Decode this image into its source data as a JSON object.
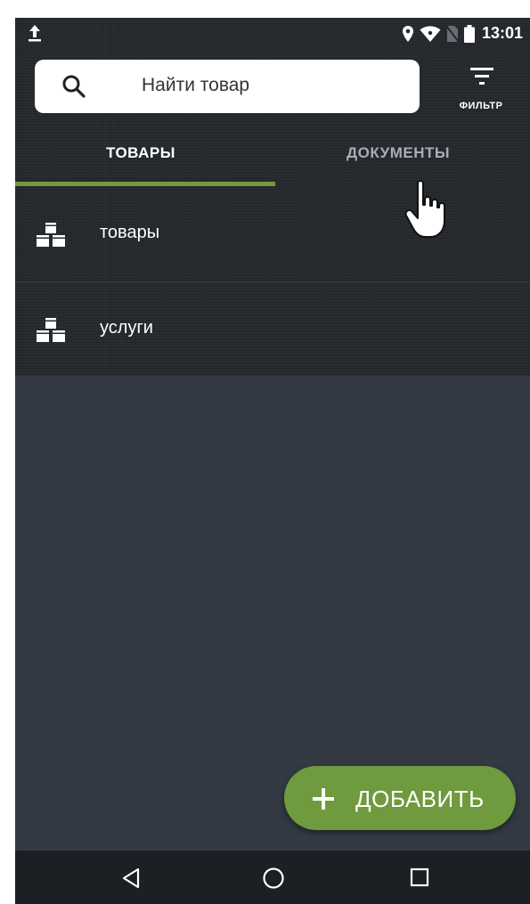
{
  "status_bar": {
    "time": "13:01"
  },
  "search": {
    "placeholder": "Найти товар"
  },
  "filter": {
    "label": "ФИЛЬТР"
  },
  "tabs": [
    {
      "label": "ТОВАРЫ",
      "selected": true
    },
    {
      "label": "ДОКУМЕНТЫ",
      "selected": false
    }
  ],
  "list": {
    "items": [
      {
        "label": "товары",
        "icon": "boxes-icon"
      },
      {
        "label": "услуги",
        "icon": "boxes-icon"
      }
    ]
  },
  "fab": {
    "label": "ДОБАВИТЬ",
    "icon": "plus-icon"
  },
  "colors": {
    "accent": "#6f9a3d",
    "header_bg": "#23262b",
    "content_bg": "#343a44",
    "navbar_bg": "#1c1f23"
  }
}
